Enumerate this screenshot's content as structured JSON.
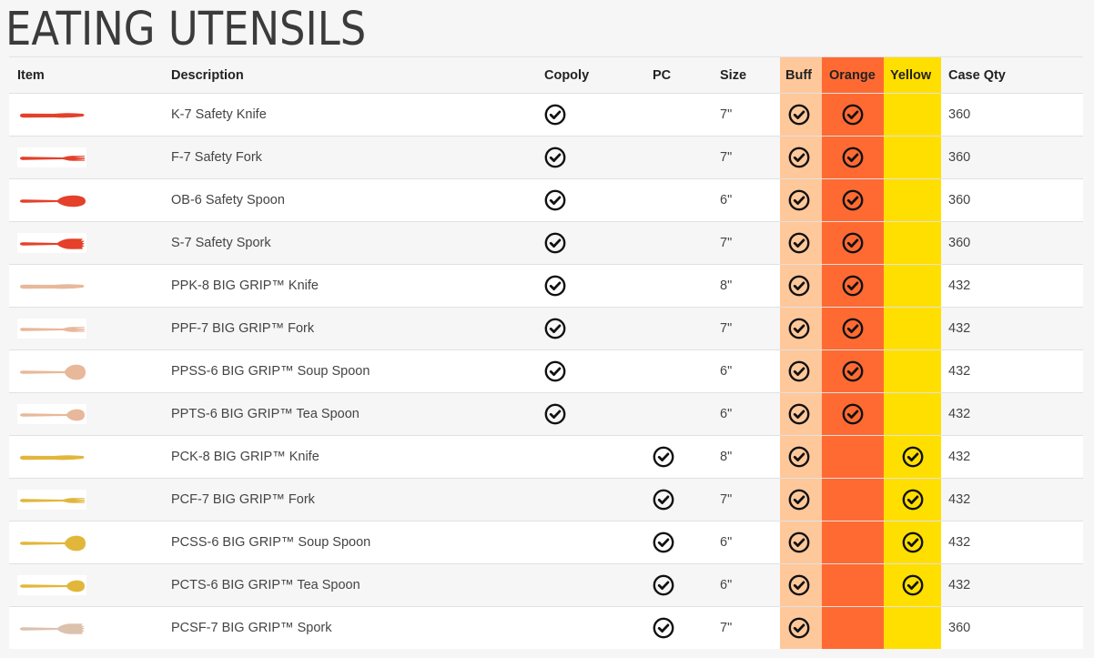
{
  "title": "EATING UTENSILS",
  "columns": {
    "item": "Item",
    "description": "Description",
    "copoly": "Copoly",
    "pc": "PC",
    "size": "Size",
    "buff": "Buff",
    "orange": "Orange",
    "yellow": "Yellow",
    "case_qty": "Case Qty"
  },
  "colors": {
    "buff": "#ffc89b",
    "orange": "#ff6a33",
    "yellow": "#ffdf00",
    "utensil_red": "#e4402a",
    "utensil_tan": "#e8b89a",
    "utensil_yellow": "#e2b63a",
    "utensil_spork_tan": "#dcc1ad"
  },
  "rows": [
    {
      "icon": "knife-icon",
      "tone": "red",
      "description": "K-7 Safety Knife",
      "copoly": true,
      "pc": false,
      "size": "7\"",
      "buff": true,
      "orange": true,
      "yellow": false,
      "case_qty": "360"
    },
    {
      "icon": "fork-icon",
      "tone": "red",
      "description": "F-7 Safety Fork",
      "copoly": true,
      "pc": false,
      "size": "7\"",
      "buff": true,
      "orange": true,
      "yellow": false,
      "case_qty": "360"
    },
    {
      "icon": "spoon-icon",
      "tone": "red",
      "description": "OB-6 Safety Spoon",
      "copoly": true,
      "pc": false,
      "size": "6\"",
      "buff": true,
      "orange": true,
      "yellow": false,
      "case_qty": "360"
    },
    {
      "icon": "spork-icon",
      "tone": "red",
      "description": "S-7 Safety Spork",
      "copoly": true,
      "pc": false,
      "size": "7\"",
      "buff": true,
      "orange": true,
      "yellow": false,
      "case_qty": "360"
    },
    {
      "icon": "knife-icon",
      "tone": "tan",
      "description": "PPK-8 BIG GRIP™ Knife",
      "copoly": true,
      "pc": false,
      "size": "8\"",
      "buff": true,
      "orange": true,
      "yellow": false,
      "case_qty": "432"
    },
    {
      "icon": "fork-icon",
      "tone": "tan",
      "description": "PPF-7 BIG GRIP™ Fork",
      "copoly": true,
      "pc": false,
      "size": "7\"",
      "buff": true,
      "orange": true,
      "yellow": false,
      "case_qty": "432"
    },
    {
      "icon": "soup-spoon-icon",
      "tone": "tan",
      "description": "PPSS-6 BIG GRIP™ Soup Spoon",
      "copoly": true,
      "pc": false,
      "size": "6\"",
      "buff": true,
      "orange": true,
      "yellow": false,
      "case_qty": "432"
    },
    {
      "icon": "tea-spoon-icon",
      "tone": "tan",
      "description": "PPTS-6 BIG GRIP™ Tea Spoon",
      "copoly": true,
      "pc": false,
      "size": "6\"",
      "buff": true,
      "orange": true,
      "yellow": false,
      "case_qty": "432"
    },
    {
      "icon": "knife-icon",
      "tone": "yellow",
      "description": "PCK-8 BIG GRIP™ Knife",
      "copoly": false,
      "pc": true,
      "size": "8\"",
      "buff": true,
      "orange": false,
      "yellow": true,
      "case_qty": "432"
    },
    {
      "icon": "fork-icon",
      "tone": "yellow",
      "description": "PCF-7 BIG GRIP™ Fork",
      "copoly": false,
      "pc": true,
      "size": "7\"",
      "buff": true,
      "orange": false,
      "yellow": true,
      "case_qty": "432"
    },
    {
      "icon": "soup-spoon-icon",
      "tone": "yellow",
      "description": "PCSS-6 BIG GRIP™ Soup Spoon",
      "copoly": false,
      "pc": true,
      "size": "6\"",
      "buff": true,
      "orange": false,
      "yellow": true,
      "case_qty": "432"
    },
    {
      "icon": "tea-spoon-icon",
      "tone": "yellow",
      "description": "PCTS-6 BIG GRIP™ Tea Spoon",
      "copoly": false,
      "pc": true,
      "size": "6\"",
      "buff": true,
      "orange": false,
      "yellow": true,
      "case_qty": "432"
    },
    {
      "icon": "spork-icon",
      "tone": "spork_tan",
      "description": "PCSF-7 BIG GRIP™ Spork",
      "copoly": false,
      "pc": true,
      "size": "7\"",
      "buff": true,
      "orange": false,
      "yellow": false,
      "case_qty": "360"
    }
  ]
}
